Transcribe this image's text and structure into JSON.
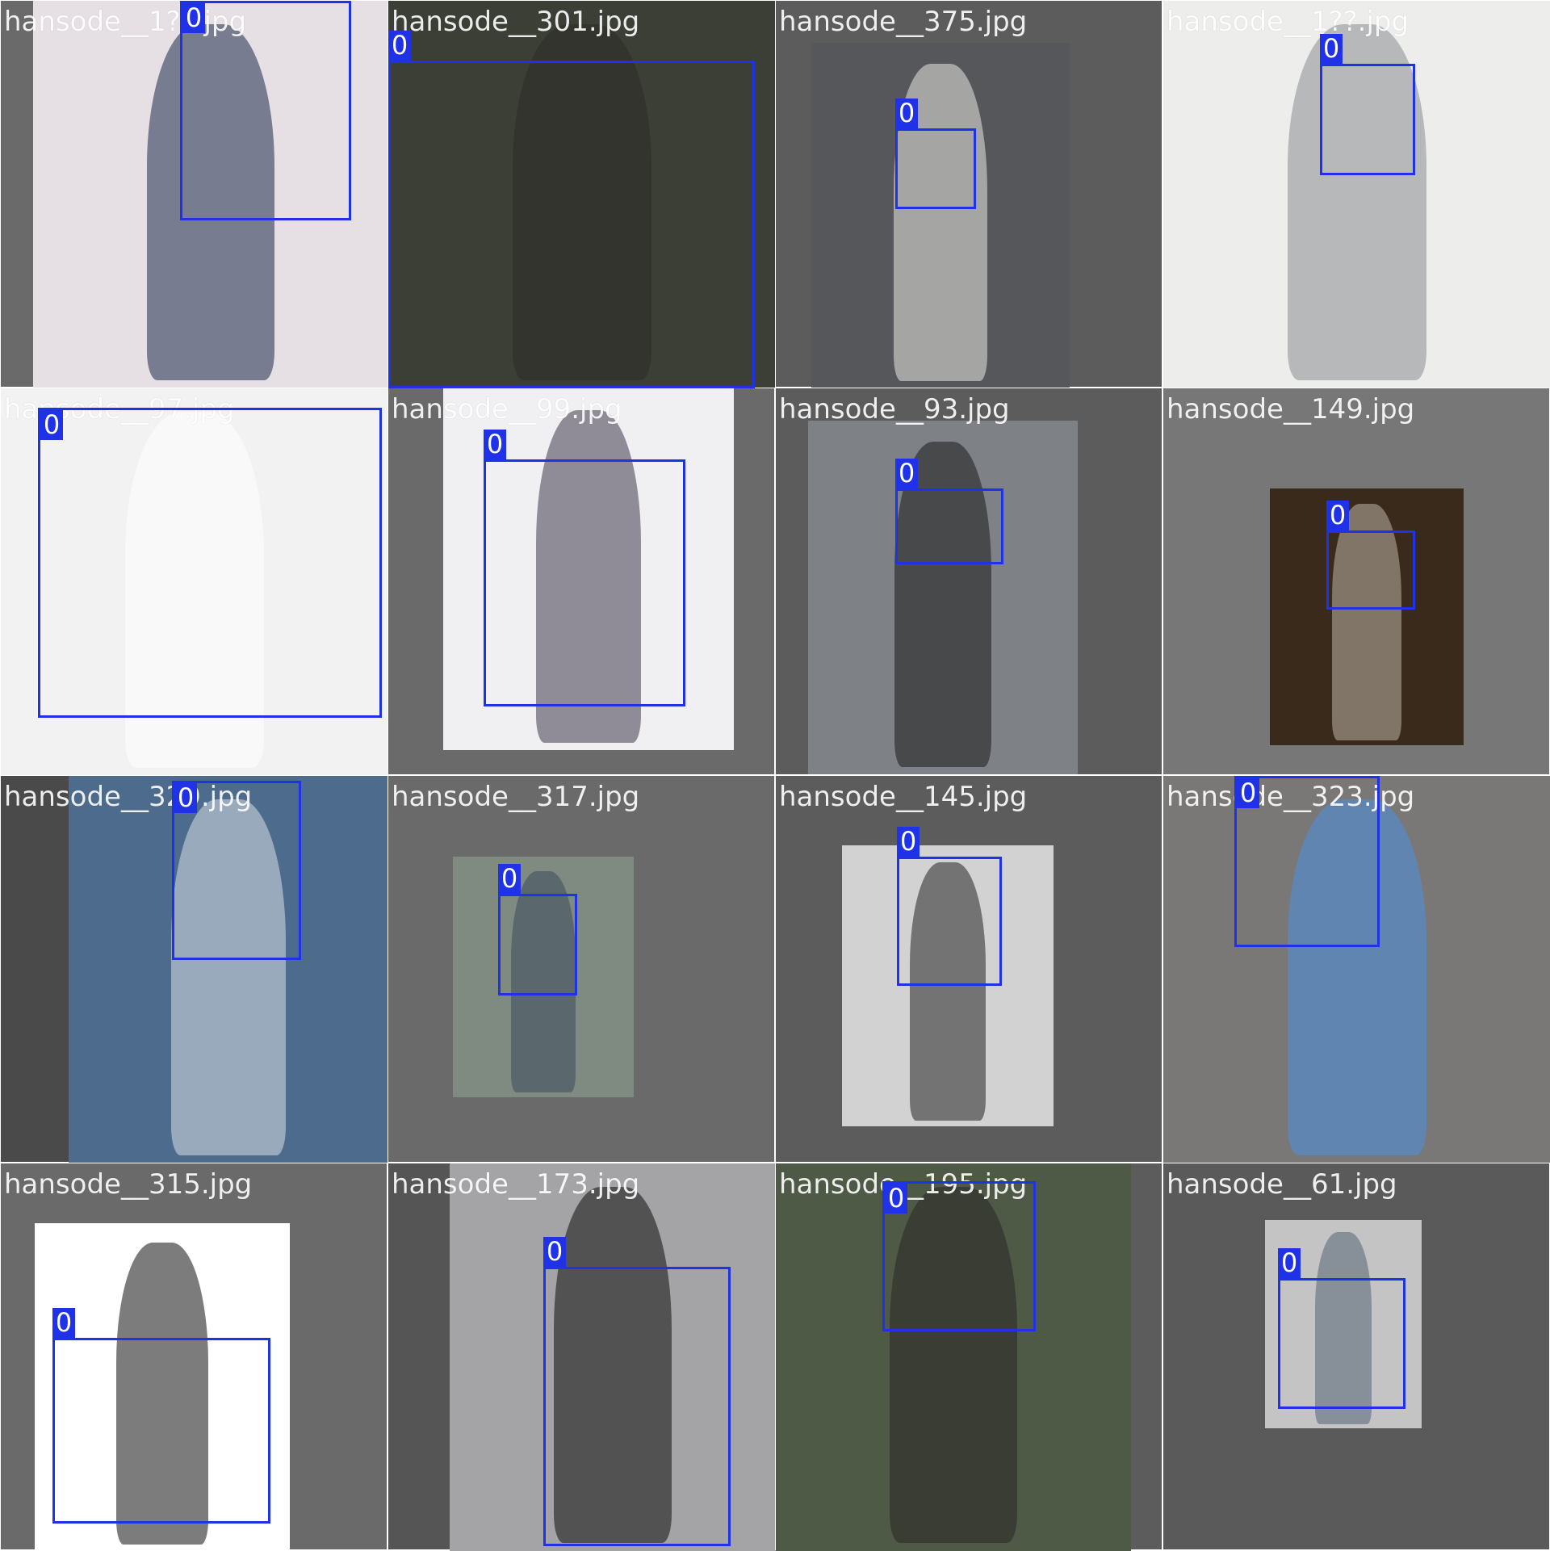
{
  "label_color": "#1f32e8",
  "tiles": [
    {
      "filename": "hansode__1??.jpg",
      "class_label": "0",
      "bg": "#6a6a6a",
      "photo_color": "#e6e0e4",
      "figure_color": "#1e2a4a"
    },
    {
      "filename": "hansode__301.jpg",
      "class_label": "0",
      "bg": "#d9dde0",
      "photo_color": "#3c3f36",
      "figure_color": "#2a2c26"
    },
    {
      "filename": "hansode__375.jpg",
      "class_label": "0",
      "bg": "#5c5c5c",
      "photo_color": "#55575a",
      "figure_color": "#e8e6e0"
    },
    {
      "filename": "hansode__1??.jpg",
      "class_label": "0",
      "bg": "#e4e4e4",
      "photo_color": "#ededeb",
      "figure_color": "#8a8c90"
    },
    {
      "filename": "hansode__97.jpg",
      "class_label": "0",
      "bg": "#8a8a8a",
      "photo_color": "#f2f2f2",
      "figure_color": "#ffffff"
    },
    {
      "filename": "hansode__99.jpg",
      "class_label": "0",
      "bg": "#6a6a6a",
      "photo_color": "#f0f0f2",
      "figure_color": "#3f3a4c"
    },
    {
      "filename": "hansode__93.jpg",
      "class_label": "0",
      "bg": "#5c5c5c",
      "photo_color": "#7e8286",
      "figure_color": "#1c1c1c"
    },
    {
      "filename": "hansode__149.jpg",
      "class_label": "0",
      "bg": "#777777",
      "photo_color": "#3a2a1c",
      "figure_color": "#b9b2a4"
    },
    {
      "filename": "hansode__329.jpg",
      "class_label": "0",
      "bg": "#4a4a4a",
      "photo_color": "#4d6b8c",
      "figure_color": "#d8dee6"
    },
    {
      "filename": "hansode__317.jpg",
      "class_label": "0",
      "bg": "#6a6a6a",
      "photo_color": "#7f8a80",
      "figure_color": "#3d4a5c"
    },
    {
      "filename": "hansode__145.jpg",
      "class_label": "0",
      "bg": "#5c5c5c",
      "photo_color": "#d2d2d2",
      "figure_color": "#242424"
    },
    {
      "filename": "hansode__323.jpg",
      "class_label": "0",
      "bg": "#7a7a7a",
      "photo_color": "#7a7876",
      "figure_color": "#4a8fe0"
    },
    {
      "filename": "hansode__315.jpg",
      "class_label": "0",
      "bg": "#6a6a6a",
      "photo_color": "#ffffff",
      "figure_color": "#111111"
    },
    {
      "filename": "hansode__173.jpg",
      "class_label": "0",
      "bg": "#555555",
      "photo_color": "#a4a4a6",
      "figure_color": "#0e0e0e"
    },
    {
      "filename": "hansode__195.jpg",
      "class_label": "0",
      "bg": "#5c5c5c",
      "photo_color": "#4e5a46",
      "figure_color": "#2a2626"
    },
    {
      "filename": "hansode__61.jpg",
      "class_label": "0",
      "bg": "#5a5a5a",
      "photo_color": "#c4c4c4",
      "figure_color": "#566676"
    }
  ]
}
